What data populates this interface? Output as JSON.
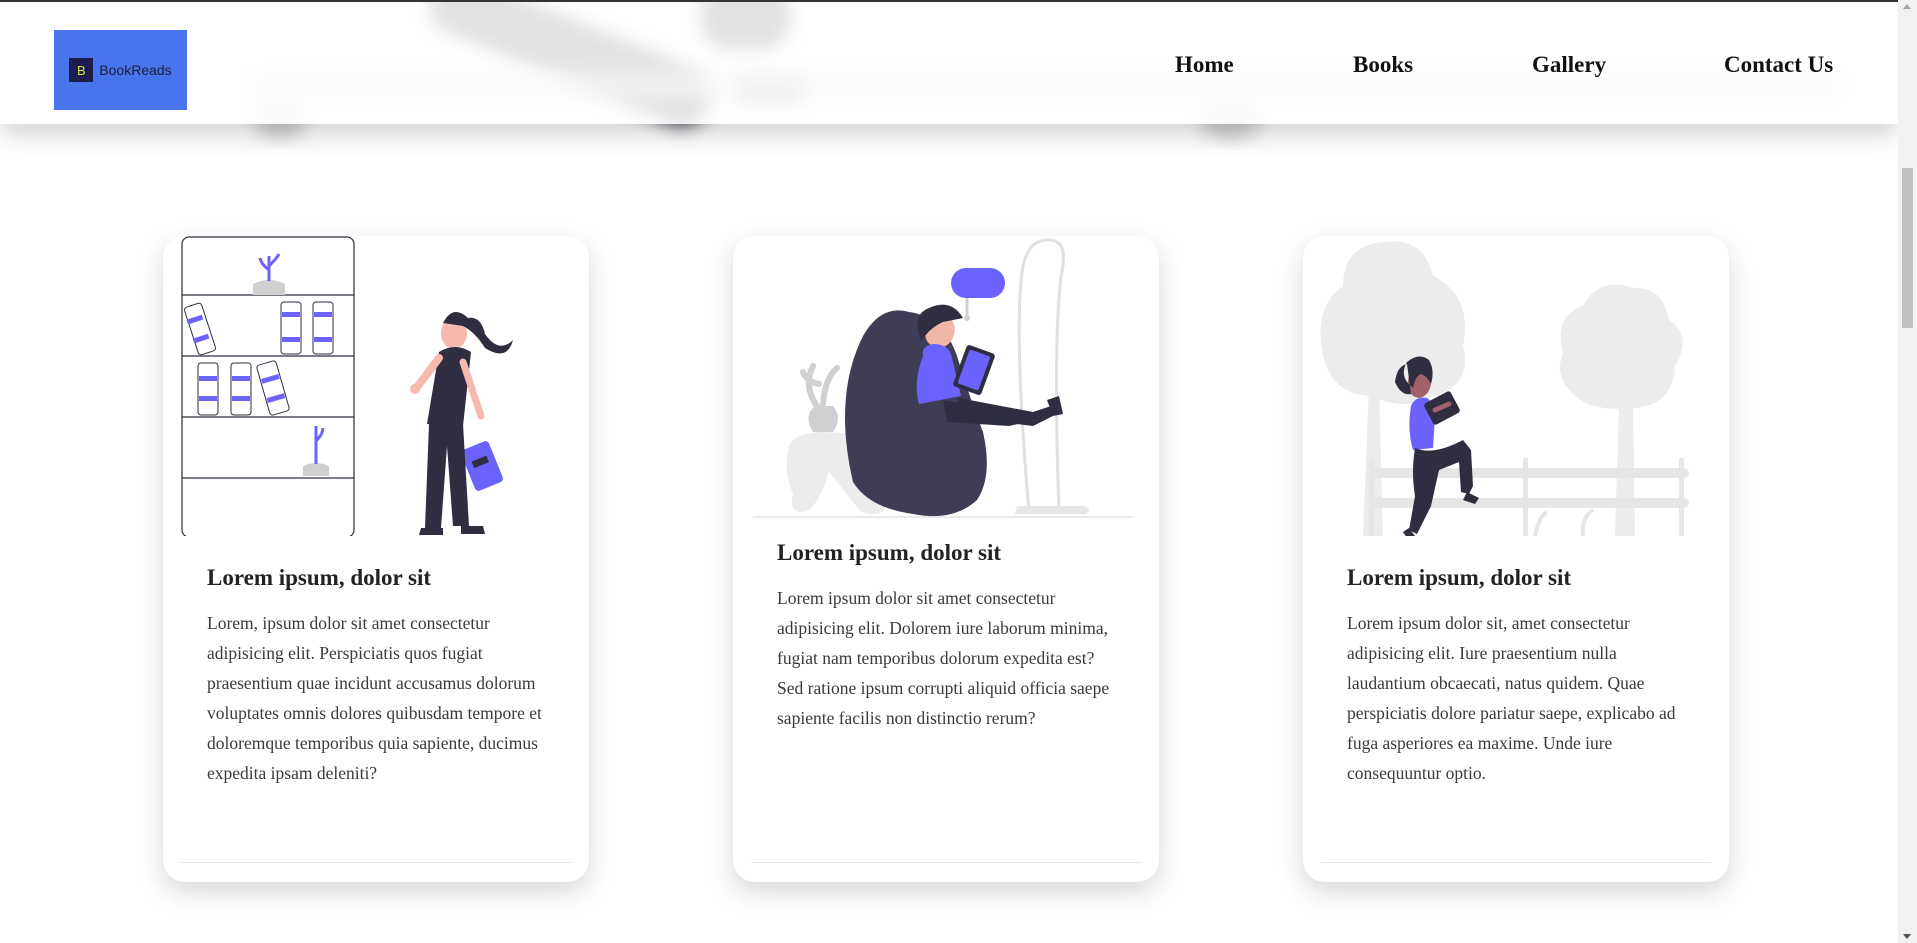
{
  "brand": {
    "mark": "B",
    "name": "BookReads",
    "color": "#4874ec"
  },
  "nav": {
    "items": [
      {
        "label": "Home"
      },
      {
        "label": "Books"
      },
      {
        "label": "Gallery"
      },
      {
        "label": "Contact Us"
      }
    ]
  },
  "cards": [
    {
      "illustration": "woman-at-bookshelf-illustration",
      "title": "Lorem ipsum, dolor sit",
      "text": "Lorem, ipsum dolor sit amet consectetur adipisicing elit. Perspiciatis quos fugiat praesentium quae incidunt accusamus dolorum voluptates omnis dolores quibusdam tempore et doloremque temporibus quia sapiente, ducimus expedita ipsam deleniti?"
    },
    {
      "illustration": "reading-in-armchair-illustration",
      "title": "Lorem ipsum, dolor sit",
      "text": "Lorem ipsum dolor sit amet consectetur adipisicing elit. Dolorem iure laborum minima, fugiat nam temporibus dolorum expedita est? Sed ratione ipsum corrupti aliquid officia saepe sapiente facilis non distinctio rerum?"
    },
    {
      "illustration": "reading-on-fence-illustration",
      "title": "Lorem ipsum, dolor sit",
      "text": "Lorem ipsum dolor sit, amet consectetur adipisicing elit. Iure praesentium nulla laudantium obcaecati, natus quidem. Quae perspiciatis dolore pariatur saepe, explicabo ad fuga asperiores ea maxime. Unde iure consequuntur optio."
    }
  ],
  "colors": {
    "accent": "#6c63ff",
    "dark": "#2f2e41",
    "muted": "#e6e6e6"
  }
}
